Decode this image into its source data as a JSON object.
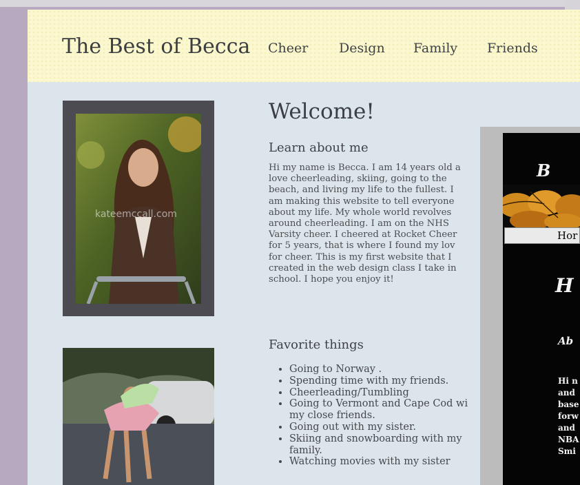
{
  "site": {
    "title": "The Best of Becca",
    "nav": [
      "Cheer",
      "Design",
      "Family",
      "Friends"
    ]
  },
  "photos": {
    "watermark": "kateemccall.com"
  },
  "main": {
    "welcome": "Welcome!",
    "about_heading": "Learn about me",
    "about_text": "Hi my name is Becca. I am 14 years old a\nlove cheerleading, skiing, going to the\nbeach, and living my life to the fullest. I\nam making this website to tell everyone\nabout my life. My whole world revolves\naround cheerleading. I am on the NHS\nVarsity cheer. I cheered at Rocket Cheer\nfor 5 years, that is where I found my lov\nfor cheer. This is my first website that I\ncreated in the web design class I take in\nschool. I hope you enjoy it!",
    "favorites_heading": "Favorite things",
    "favorites": [
      "Going to Norway .",
      "Spending time with my friends.",
      "Cheerleading/Tumbling",
      "Going to Vermont and Cape Cod wi\nmy close friends.",
      "Going out with my sister.",
      "Skiing and snowboarding with my\nfamily.",
      "Watching movies with my sister"
    ]
  },
  "overlay": {
    "title": "B",
    "menu_item": "Hor",
    "heading": "H",
    "subheading": "Ab",
    "text": "Hi n\nand\nbase\nforw\nand\nNBA\nSmi"
  },
  "colors": {
    "header_bg": "#fbf8cf",
    "page_bg": "#dce5ec",
    "frame": "#4c4b52",
    "side_border": "#b7a9bf"
  }
}
